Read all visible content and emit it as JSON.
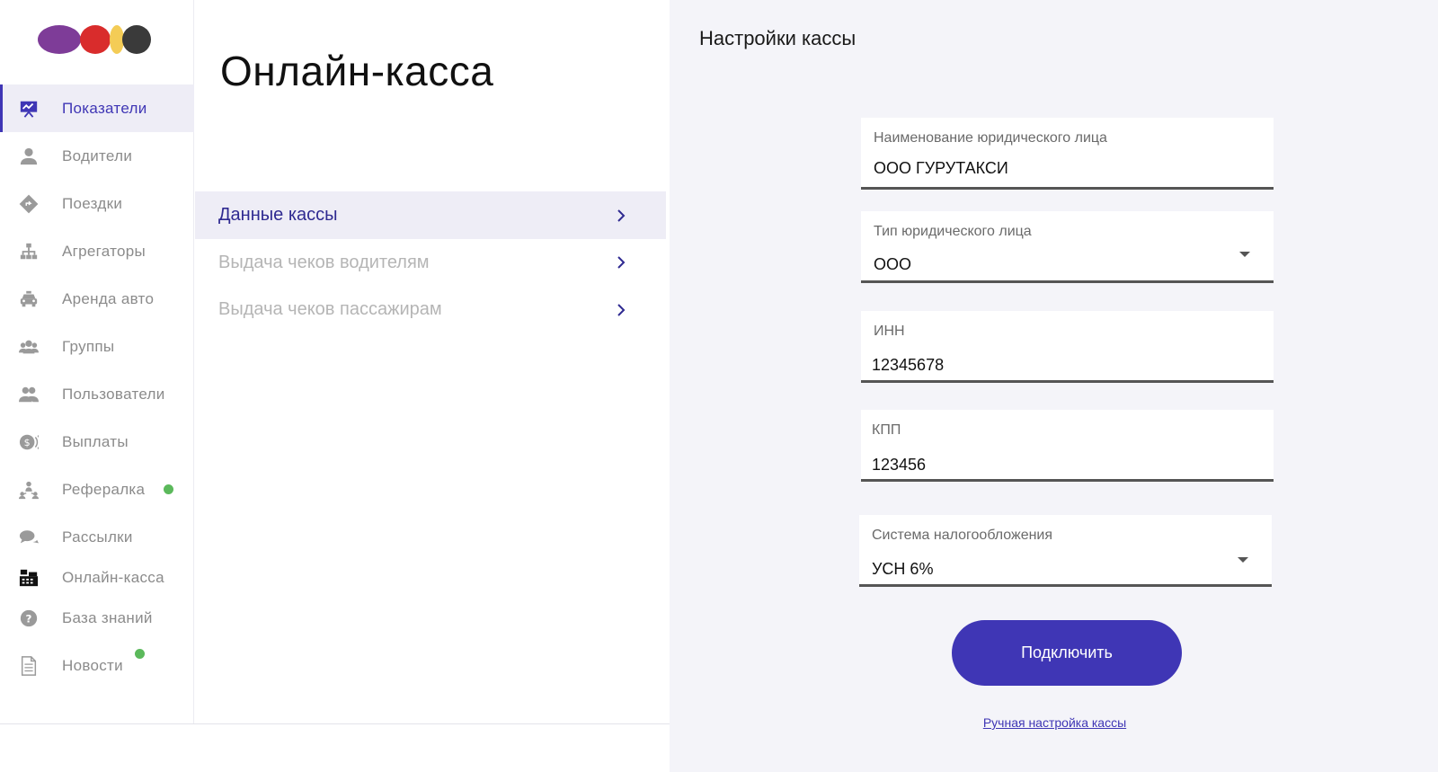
{
  "sidebar": {
    "logo_colors": [
      "#7e3c98",
      "#d92c2c",
      "#f4cc56",
      "#3a3a3a"
    ],
    "items": [
      {
        "label": "Показатели",
        "icon": "presentation-chart-icon",
        "active": true
      },
      {
        "label": "Водители",
        "icon": "user-icon"
      },
      {
        "label": "Поездки",
        "icon": "route-sign-icon"
      },
      {
        "label": "Агрегаторы",
        "icon": "hierarchy-icon"
      },
      {
        "label": "Аренда авто",
        "icon": "car-icon"
      },
      {
        "label": "Группы",
        "icon": "group-icon"
      },
      {
        "label": "Пользователи",
        "icon": "users-icon"
      },
      {
        "label": "Выплаты",
        "icon": "coin-icon"
      },
      {
        "label": "Рефералка",
        "icon": "referral-icon",
        "badge": true
      },
      {
        "label": "Рассылки",
        "icon": "chat-icon"
      },
      {
        "label": "Онлайн-касса",
        "icon": "cash-register-icon"
      },
      {
        "label": "База знаний",
        "icon": "question-icon"
      },
      {
        "label": "Новости",
        "icon": "document-icon",
        "badge": true
      }
    ],
    "badge_color": "#5bb95b"
  },
  "middle": {
    "title": "Онлайн-касса",
    "submenu": [
      {
        "label": "Данные кассы",
        "active": true
      },
      {
        "label": "Выдача чеков водителям"
      },
      {
        "label": "Выдача чеков пассажирам"
      }
    ]
  },
  "panel": {
    "title": "Настройки кассы",
    "fields": {
      "legal_name": {
        "label": "Наименование юридического лица",
        "value": "ООО ГУРУТАКСИ"
      },
      "legal_type": {
        "label": "Тип юридического лица",
        "value": "ООО"
      },
      "inn": {
        "label": "ИНН",
        "value": "12345678"
      },
      "kpp": {
        "label": "КПП",
        "value": "123456"
      },
      "tax_system": {
        "label": "Система налогообложения",
        "value": "УСН 6%"
      }
    },
    "connect_button": "Подключить",
    "manual_link": "Ручная настройка кассы"
  },
  "accent_color": "#3f36b5"
}
